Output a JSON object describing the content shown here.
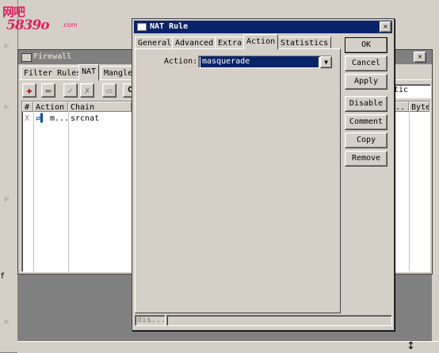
{
  "watermark": {
    "line1": "网吧",
    "line2": "5839o",
    "line3": ".com"
  },
  "side_letter": "f",
  "firewall": {
    "title": "Firewall",
    "tabs": [
      "Filter Rules",
      "NAT",
      "Mangle"
    ],
    "active_tab": "NAT",
    "columns": [
      "#",
      "Action",
      "Chain",
      "...",
      "Byte"
    ],
    "rows": [
      {
        "num": "X",
        "action": "m...",
        "chain": "srcnat"
      }
    ],
    "right_select_value": "atic",
    "toolbar_icons": [
      "add-icon",
      "remove-icon",
      "enable-icon",
      "disable-icon",
      "comment-icon"
    ]
  },
  "dialog": {
    "title": "NAT Rule",
    "tabs": [
      "General",
      "Advanced",
      "Extra",
      "Action",
      "Statistics"
    ],
    "active_tab": "Action",
    "action_label": "Action:",
    "action_value": "masquerade",
    "buttons": {
      "ok": "OK",
      "cancel": "Cancel",
      "apply": "Apply",
      "disable": "Disable",
      "comment": "Comment",
      "copy": "Copy",
      "remove": "Remove"
    },
    "status": "dis..."
  },
  "colors": {
    "title_active": "#0a246a",
    "title_inactive": "#808080",
    "face": "#d4d0c8",
    "watermark": "#e0205e"
  }
}
